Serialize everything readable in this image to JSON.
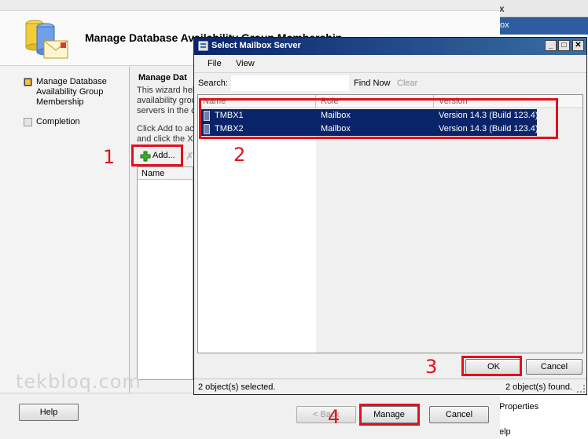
{
  "background_window": {
    "close_glyph": "x",
    "header_text": "ox",
    "properties_text": "Properties",
    "help_text": "elp"
  },
  "wizard": {
    "title": "Manage Database Availability Group Membership",
    "steps": [
      {
        "label": "Manage Database Availability Group Membership",
        "status": "current"
      },
      {
        "label": "Completion",
        "status": "pending"
      }
    ],
    "content_title": "Manage Dat",
    "description": "This wizard hel availability grou servers in the c",
    "instruction": "Click Add to ac and click the X",
    "add_button": "Add...",
    "members_column_header": "Name",
    "buttons": {
      "help": "Help",
      "back": "< Back",
      "manage": "Manage",
      "cancel": "Cancel"
    },
    "watermark": "tekbloq.com"
  },
  "dialog": {
    "title": "Select Mailbox Server",
    "menu": [
      "File",
      "View"
    ],
    "search_label": "Search:",
    "search_value": "",
    "find_now": "Find Now",
    "clear": "Clear",
    "columns": [
      "Name",
      "Role",
      "Version"
    ],
    "rows": [
      {
        "name": "TMBX1",
        "role": "Mailbox",
        "version": "Version 14.3 (Build 123.4)",
        "selected": true
      },
      {
        "name": "TMBX2",
        "role": "Mailbox",
        "version": "Version 14.3 (Build 123.4)",
        "selected": true
      }
    ],
    "ok_button": "OK",
    "cancel_button": "Cancel",
    "status_selected": "2 object(s) selected.",
    "status_found": "2 object(s) found."
  },
  "annotations": {
    "step1": "1",
    "step2": "2",
    "step3": "3",
    "step4": "4",
    "color": "#e3101b"
  },
  "colors": {
    "selection": "#0a246a",
    "titlebar": "#0a246a",
    "background_header": "#2d5d9f"
  }
}
